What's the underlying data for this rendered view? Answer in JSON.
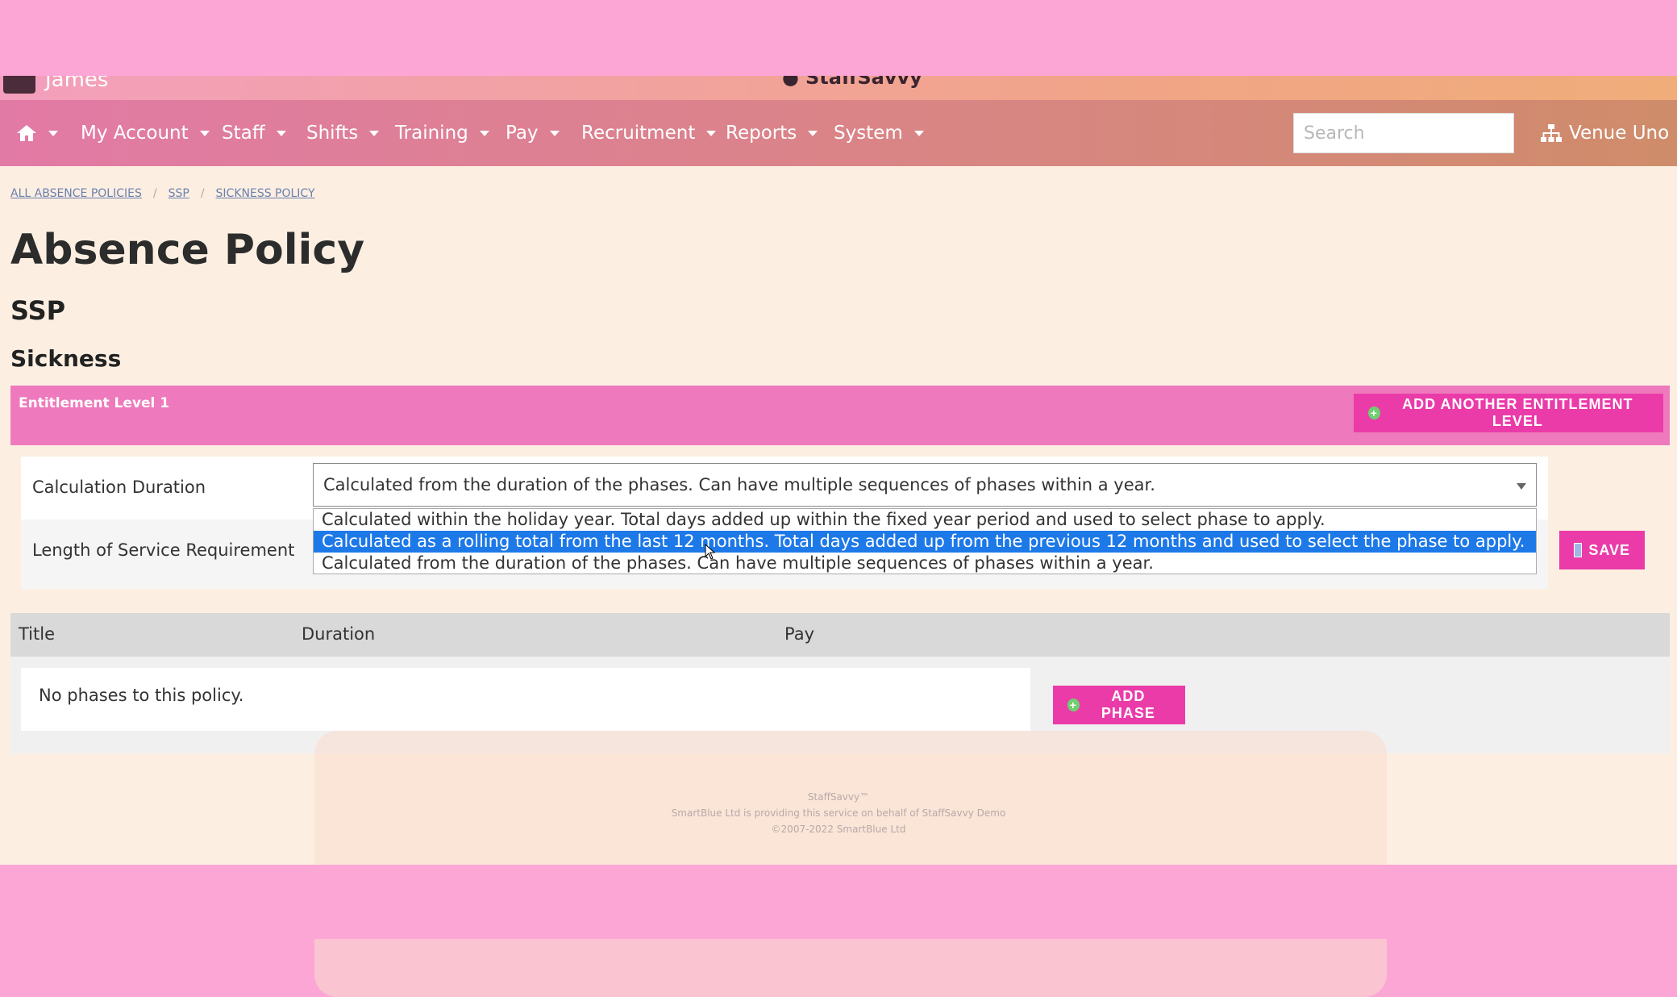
{
  "app": {
    "user_name": "James",
    "brand": "StaffSavvy",
    "colors": {
      "accent": "#ea3ba9",
      "header_pink": "#ee7abd",
      "selected_option": "#1e79e8"
    }
  },
  "nav": {
    "home_icon": "home-icon",
    "items": [
      "My Account",
      "Staff",
      "Shifts",
      "Training",
      "Pay",
      "Recruitment",
      "Reports",
      "System"
    ],
    "search_placeholder": "Search",
    "venue": "Venue Uno"
  },
  "breadcrumb": [
    "ALL ABSENCE POLICIES",
    "SSP",
    "SICKNESS POLICY"
  ],
  "page": {
    "title": "Absence Policy",
    "subtitle": "SSP",
    "section": "Sickness"
  },
  "entitlement": {
    "title": "Entitlement Level 1",
    "add_button": "ADD ANOTHER ENTITLEMENT LEVEL",
    "calc_label": "Calculation Duration",
    "calc_value": "Calculated from the duration of the phases. Can have multiple sequences of phases within a year.",
    "service_label": "Length of Service Requirement",
    "save_button": "SAVE",
    "options": [
      "Calculated within the holiday year. Total days added up within the fixed year period and used to select phase to apply.",
      "Calculated as a rolling total from the last 12 months. Total days added up from the previous 12 months and used to select the phase to apply.",
      "Calculated from the duration of the phases. Can have multiple sequences of phases within a year."
    ]
  },
  "phases": {
    "columns": [
      "Title",
      "Duration",
      "Pay"
    ],
    "empty_text": "No phases to this policy.",
    "add_button": "ADD PHASE"
  },
  "footer": {
    "line1": "StaffSavvy™",
    "line2": "SmartBlue Ltd is providing this service on behalf of StaffSavvy Demo",
    "line3": "©2007-2022 SmartBlue Ltd"
  }
}
